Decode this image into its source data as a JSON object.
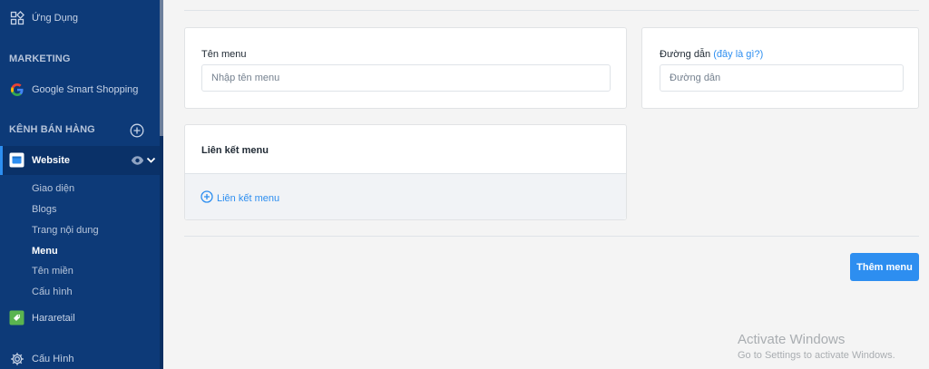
{
  "sidebar": {
    "apps_label": "Ứng Dụng",
    "marketing_heading": "MARKETING",
    "google_shopping_label": "Google Smart Shopping",
    "sales_channels_heading": "KÊNH BÁN HÀNG",
    "website_label": "Website",
    "sub_items": [
      "Giao diện",
      "Blogs",
      "Trang nội dung",
      "Menu",
      "Tên miền",
      "Cấu hình"
    ],
    "active_sub_item": "Menu",
    "hararetail_label": "Hararetail",
    "settings_label": "Cấu Hình"
  },
  "form": {
    "menu_name_label": "Tên menu",
    "menu_name_placeholder": "Nhập tên menu",
    "menu_name_value": "",
    "path_label": "Đường dẫn",
    "path_help_link": "(đây là gì?)",
    "path_placeholder": "Đường dẫn",
    "path_value": ""
  },
  "links_card": {
    "title": "Liên kết menu",
    "add_link_label": "Liên kết menu"
  },
  "actions": {
    "add_menu_button": "Thêm menu"
  },
  "watermark": {
    "title": "Activate Windows",
    "subtitle": "Go to Settings to activate Windows."
  },
  "colors": {
    "sidebar_bg": "#0d3a78",
    "accent": "#2d8ef0",
    "page_bg": "#f4f4f4"
  }
}
